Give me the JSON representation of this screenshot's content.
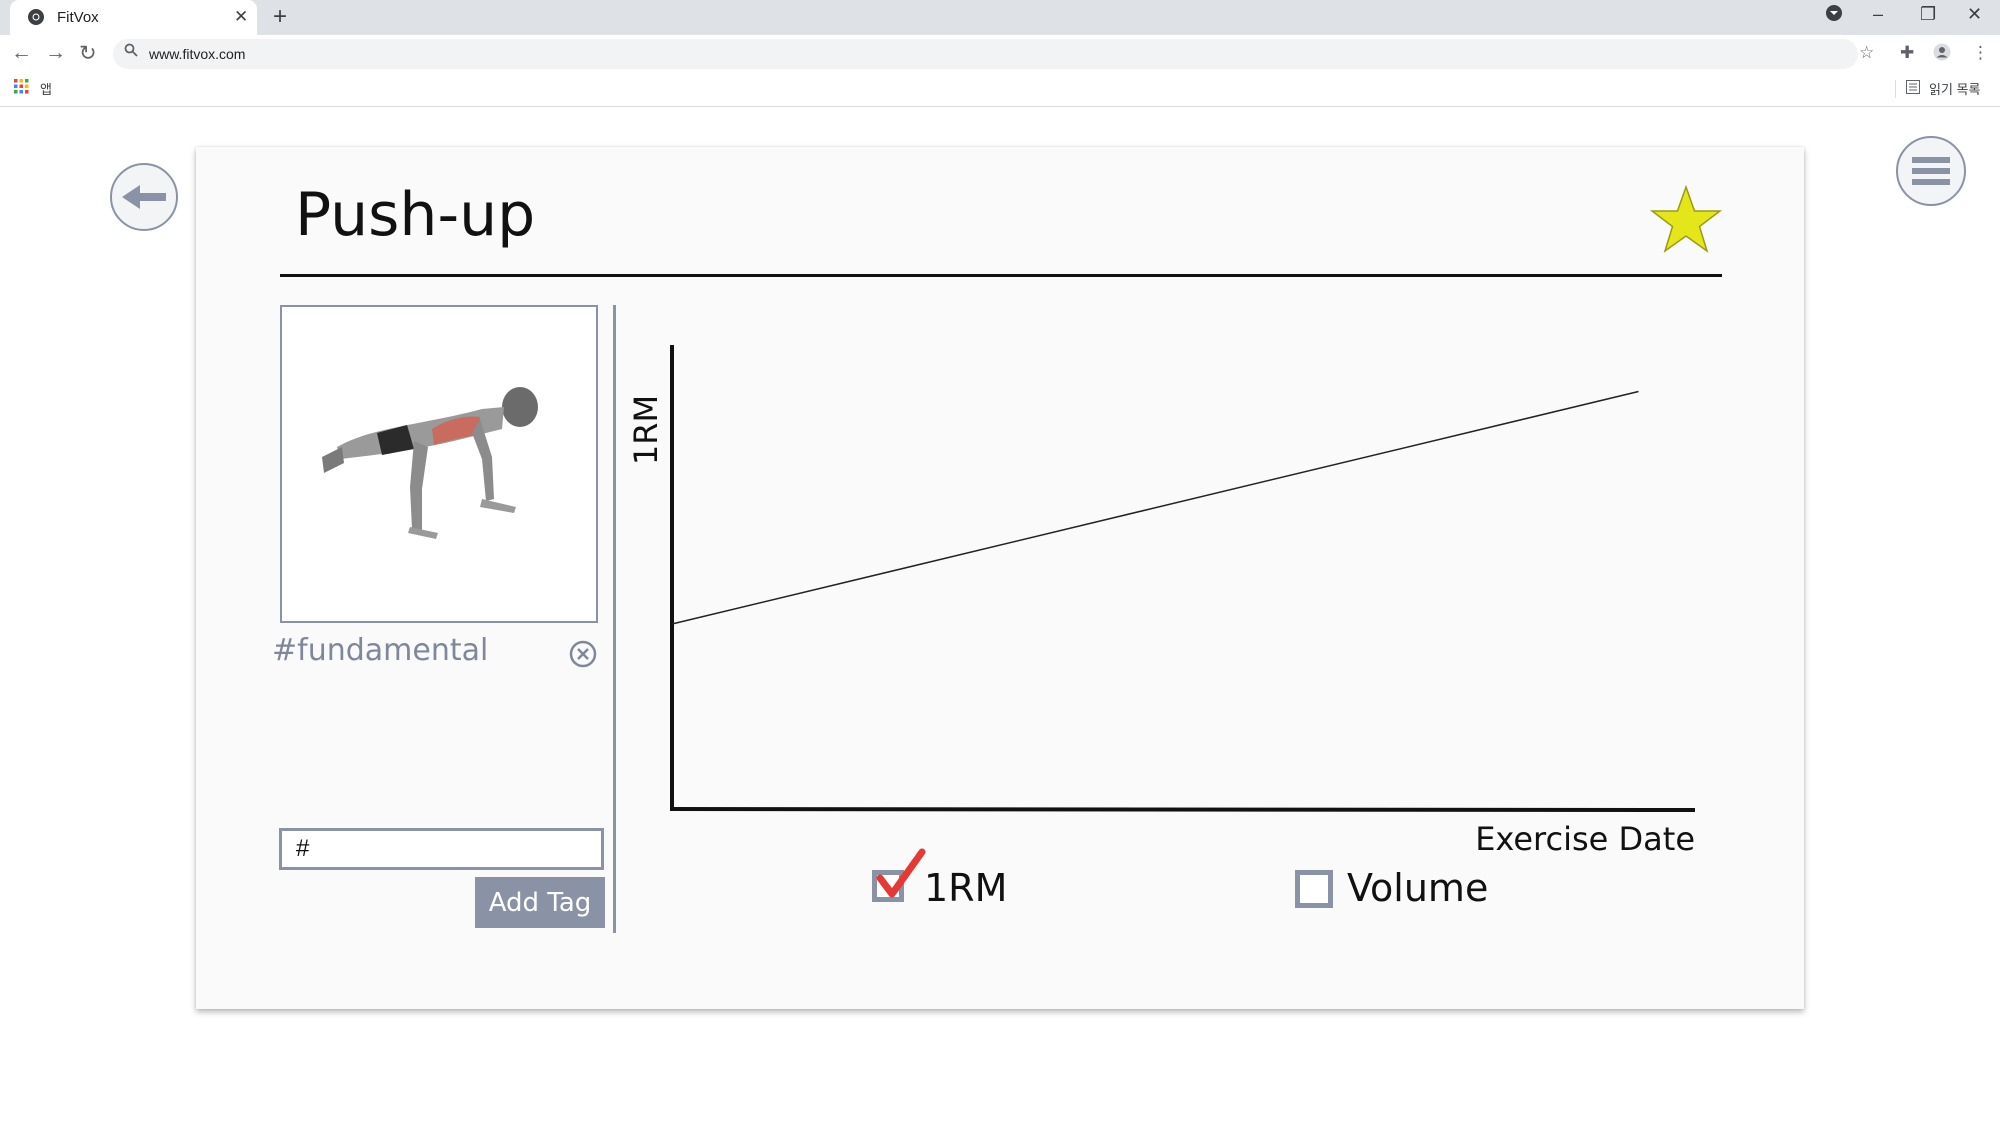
{
  "browser": {
    "tab_title": "FitVox",
    "url": "www.fitvox.com",
    "apps_label": "앱",
    "reading_list_label": "읽기 목록"
  },
  "page": {
    "title": "Push-up",
    "favorite": true,
    "tag": "#fundamental",
    "tag_input_value": "#",
    "add_tag_label": "Add Tag"
  },
  "chart_data": {
    "type": "line",
    "title": "",
    "xlabel": "Exercise Date",
    "ylabel": "1RM",
    "grid": false,
    "series": [
      {
        "values": [
          0.4,
          0.9
        ]
      }
    ],
    "note_units": "no tick labels shown"
  },
  "toggles": [
    {
      "label": "1RM",
      "checked": true
    },
    {
      "label": "Volume",
      "checked": false
    }
  ],
  "colors": {
    "accent": "#8a93a6",
    "star": "#e5e619",
    "check": "#e53935"
  }
}
